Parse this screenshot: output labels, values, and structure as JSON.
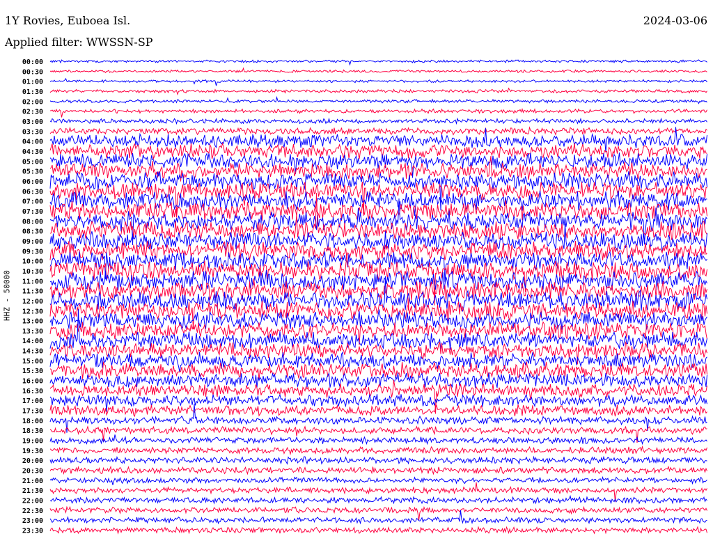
{
  "header": {
    "station": "1Y Rovies, Euboea Isl.",
    "filter": "Applied filter: WWSSN-SP",
    "date": "2024-03-06"
  },
  "chart_data": {
    "type": "line",
    "title": "1Y Rovies, Euboea Isl.",
    "ylabel": "HHZ - 50000",
    "xlabel": "",
    "tick_labels": [
      "00:00",
      "00:30",
      "01:00",
      "01:30",
      "02:00",
      "02:30",
      "03:00",
      "03:30",
      "04:00",
      "04:30",
      "05:00",
      "05:30",
      "06:00",
      "06:30",
      "07:00",
      "07:30",
      "08:00",
      "08:30",
      "09:00",
      "09:30",
      "10:00",
      "10:30",
      "11:00",
      "11:30",
      "12:00",
      "12:30",
      "13:00",
      "13:30",
      "14:00",
      "14:30",
      "15:00",
      "15:30",
      "16:00",
      "16:30",
      "17:00",
      "17:30",
      "18:00",
      "18:30",
      "19:00",
      "19:30",
      "20:00",
      "20:30",
      "21:00",
      "21:30",
      "22:00",
      "22:30",
      "23:00",
      "23:30"
    ],
    "series_colors": [
      "#0000ff",
      "#ff0040"
    ],
    "relative_amplitude": [
      0.2,
      0.2,
      0.2,
      0.25,
      0.25,
      0.3,
      0.35,
      0.5,
      1.0,
      1.1,
      1.2,
      1.2,
      1.3,
      1.3,
      1.4,
      1.4,
      1.4,
      1.4,
      1.4,
      1.4,
      1.4,
      1.4,
      1.4,
      1.4,
      1.4,
      1.4,
      1.3,
      1.3,
      1.3,
      1.2,
      1.2,
      1.2,
      1.1,
      1.0,
      0.9,
      0.8,
      0.6,
      0.55,
      0.5,
      0.5,
      0.5,
      0.5,
      0.45,
      0.45,
      0.45,
      0.45,
      0.45,
      0.45
    ]
  }
}
